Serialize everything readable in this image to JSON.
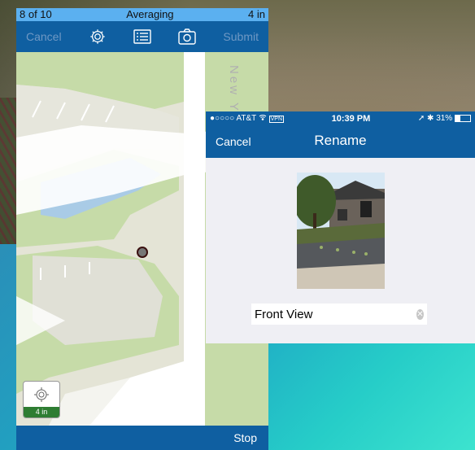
{
  "left_app": {
    "status": {
      "progress": "8 of 10",
      "mode": "Averaging",
      "accuracy": "4 in"
    },
    "toolbar": {
      "cancel_label": "Cancel",
      "submit_label": "Submit",
      "icons": [
        "gear-icon",
        "list-icon",
        "camera-icon"
      ]
    },
    "map": {
      "street_label": "New York"
    },
    "gps_badge": {
      "icon": "gps-target-icon",
      "label": "4 in"
    },
    "bottom": {
      "stop_label": "Stop"
    },
    "colors": {
      "toolbar": "#0f5fa1",
      "status": "#5bb0f0",
      "badge": "#2e7d32"
    }
  },
  "rename_screen": {
    "status": {
      "carrier": "AT&T",
      "vpn": "VPN",
      "time": "10:39 PM",
      "battery": "31%"
    },
    "nav": {
      "cancel_label": "Cancel",
      "title": "Rename"
    },
    "photo": {
      "description_icon": "house-photo"
    },
    "name_input": {
      "value": "Front View"
    }
  }
}
